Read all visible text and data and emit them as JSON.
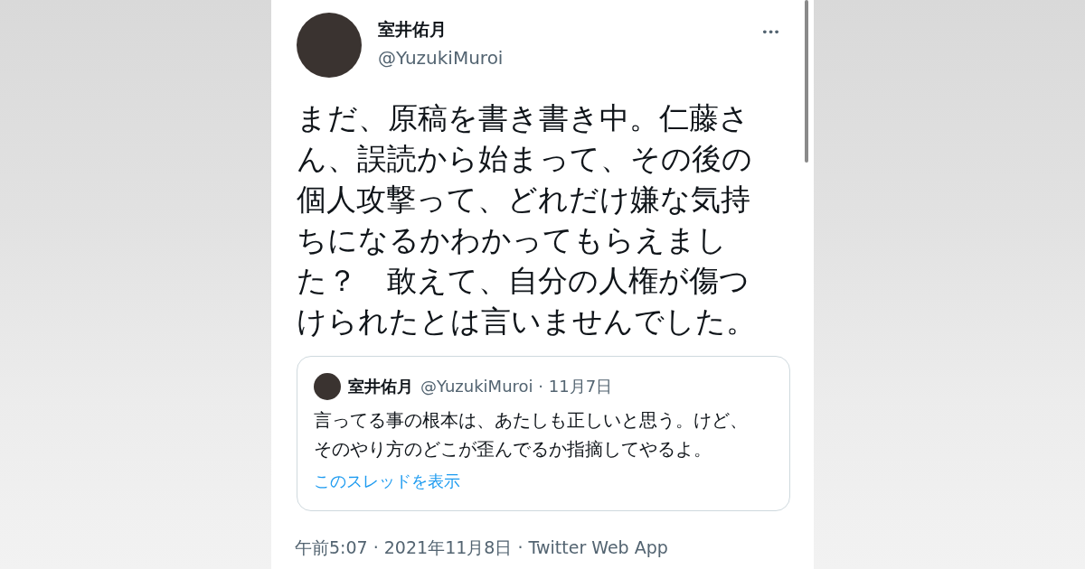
{
  "tweet": {
    "author": {
      "name": "室井佑月",
      "handle": "@YuzukiMuroi"
    },
    "more_menu": "•••",
    "text": "まだ、原稿を書き書き中。仁藤さん、誤読から始まって、その後の個人攻撃って、どれだけ嫌な気持ちになるかわかってもらえました？　敢えて、自分の人権が傷つけられたとは言いませんでした。",
    "quoted": {
      "name": "室井佑月",
      "handle_date": "@YuzukiMuroi · 11月7日",
      "text": "言ってる事の根本は、あたしも正しいと思う。けど、そのやり方のどこが歪んでるか指摘してやるよ。",
      "link": "このスレッドを表示"
    },
    "meta": "午前5:07 · 2021年11月8日 · Twitter Web App"
  }
}
